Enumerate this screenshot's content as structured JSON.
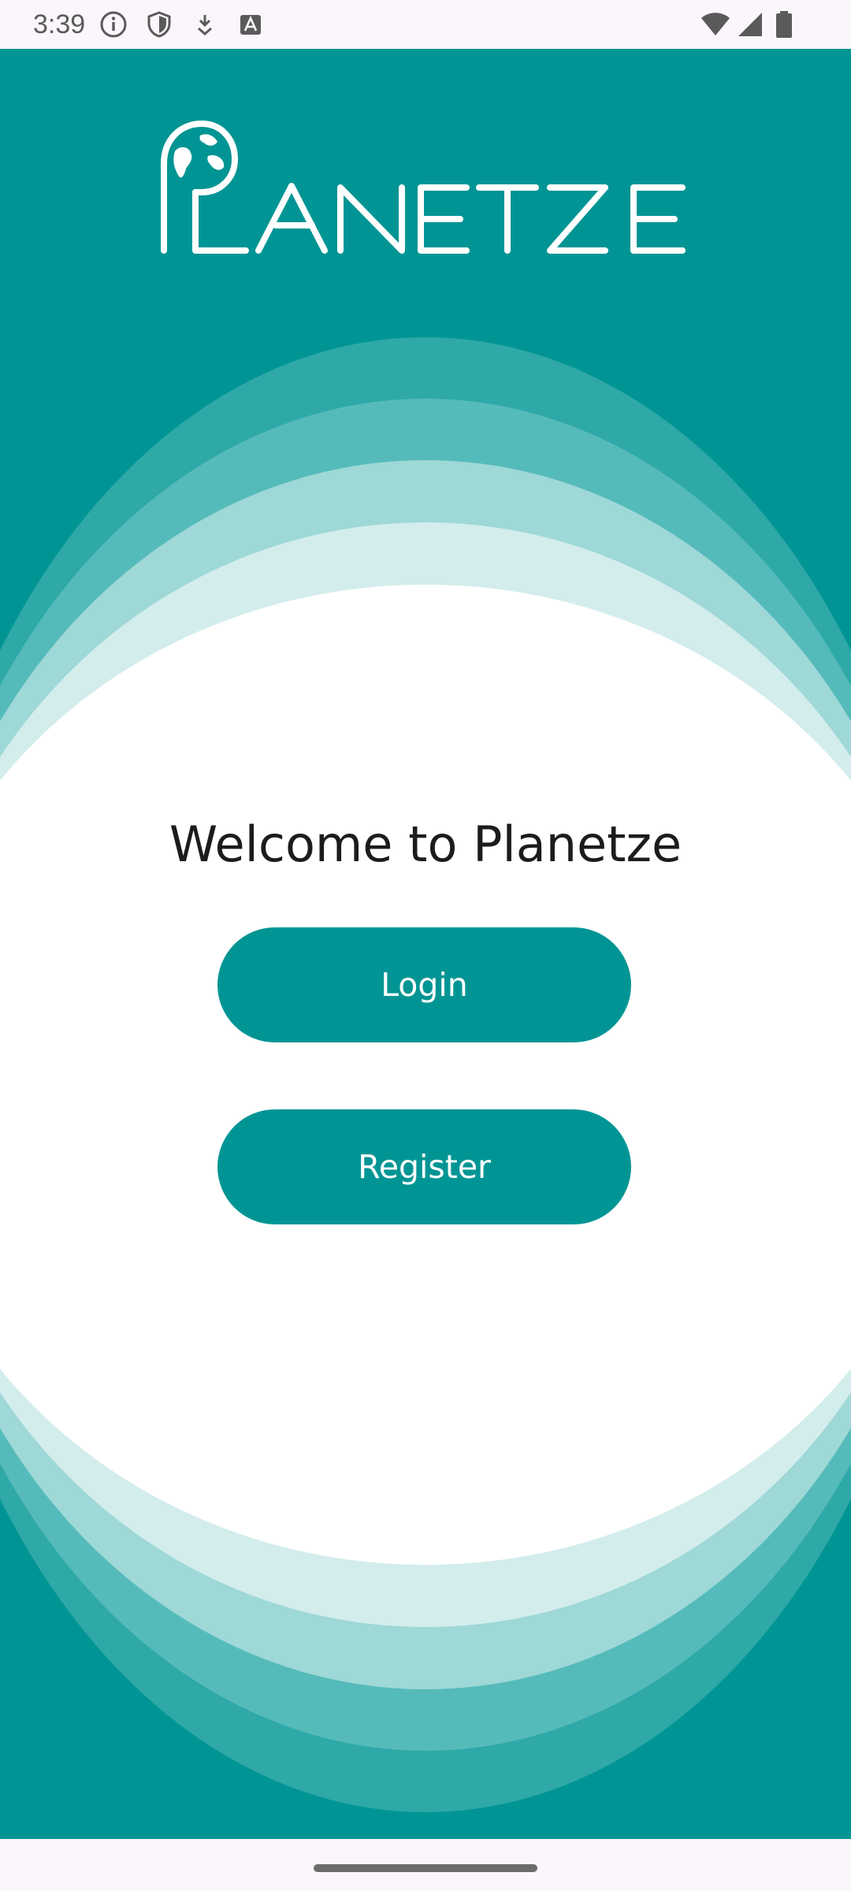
{
  "status_bar": {
    "time": "3:39",
    "left_icons": [
      "info-icon",
      "shield-icon",
      "download-icon",
      "keyboard-a-icon"
    ],
    "right_icons": [
      "wifi-icon",
      "cell-signal-icon",
      "battery-icon"
    ]
  },
  "logo": {
    "text": "PLANETZE",
    "icon": "globe-icon"
  },
  "welcome": {
    "title": "Welcome to Planetze"
  },
  "actions": {
    "login_label": "Login",
    "register_label": "Register"
  },
  "colors": {
    "primary": "#009594",
    "ring_1": "#2ea9a8",
    "ring_2": "#55bbba",
    "ring_3": "#9ed8d7",
    "ring_4": "#d3edec",
    "surface": "#ffffff",
    "system_bar": "#fbf6fb"
  }
}
